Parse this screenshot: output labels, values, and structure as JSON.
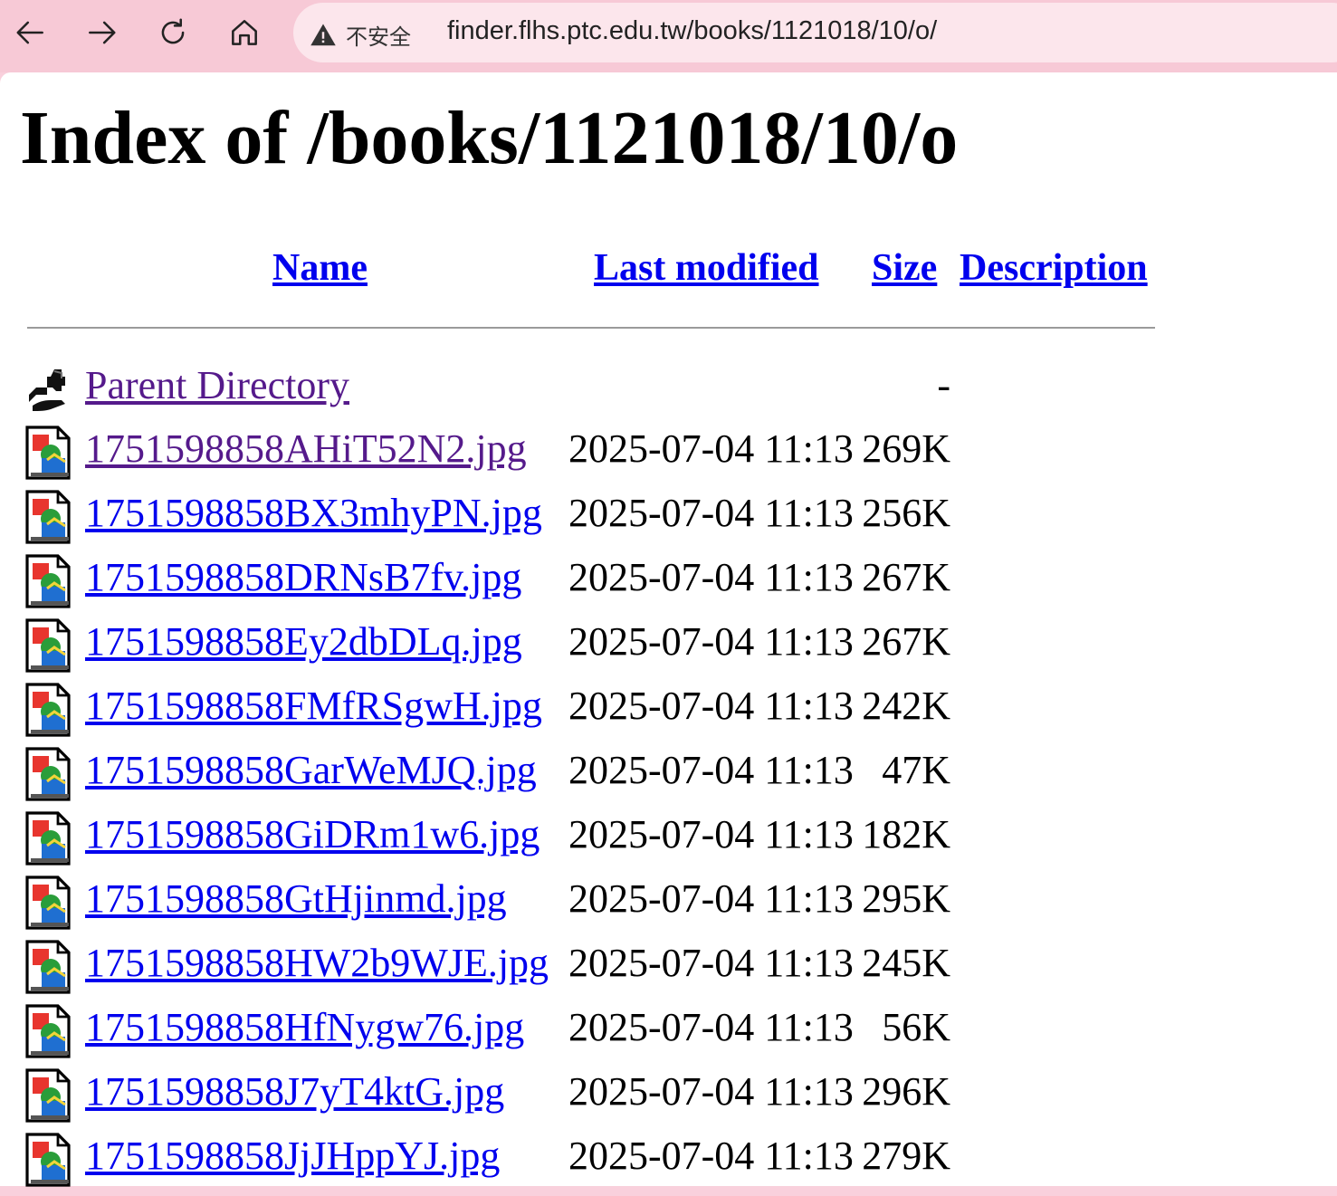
{
  "browser": {
    "security_label": "不安全",
    "url": "finder.flhs.ptc.edu.tw/books/1121018/10/o/"
  },
  "page": {
    "title": "Index of /books/1121018/10/o",
    "headers": {
      "name": "Name",
      "last_modified": "Last modified",
      "size": "Size",
      "description": "Description"
    },
    "parent": {
      "label": "Parent Directory",
      "size": "-"
    },
    "files": [
      {
        "name": "1751598858AHiT52N2.jpg",
        "modified": "2025-07-04 11:13",
        "size": "269K",
        "description": "",
        "visited": true
      },
      {
        "name": "1751598858BX3mhyPN.jpg",
        "modified": "2025-07-04 11:13",
        "size": "256K",
        "description": "",
        "visited": false
      },
      {
        "name": "1751598858DRNsB7fv.jpg",
        "modified": "2025-07-04 11:13",
        "size": "267K",
        "description": "",
        "visited": false
      },
      {
        "name": "1751598858Ey2dbDLq.jpg",
        "modified": "2025-07-04 11:13",
        "size": "267K",
        "description": "",
        "visited": false
      },
      {
        "name": "1751598858FMfRSgwH.jpg",
        "modified": "2025-07-04 11:13",
        "size": "242K",
        "description": "",
        "visited": false
      },
      {
        "name": "1751598858GarWeMJQ.jpg",
        "modified": "2025-07-04 11:13",
        "size": "47K",
        "description": "",
        "visited": false
      },
      {
        "name": "1751598858GiDRm1w6.jpg",
        "modified": "2025-07-04 11:13",
        "size": "182K",
        "description": "",
        "visited": false
      },
      {
        "name": "1751598858GtHjinmd.jpg",
        "modified": "2025-07-04 11:13",
        "size": "295K",
        "description": "",
        "visited": false
      },
      {
        "name": "1751598858HW2b9WJE.jpg",
        "modified": "2025-07-04 11:13",
        "size": "245K",
        "description": "",
        "visited": false
      },
      {
        "name": "1751598858HfNygw76.jpg",
        "modified": "2025-07-04 11:13",
        "size": "56K",
        "description": "",
        "visited": false
      },
      {
        "name": "1751598858J7yT4ktG.jpg",
        "modified": "2025-07-04 11:13",
        "size": "296K",
        "description": "",
        "visited": false
      },
      {
        "name": "1751598858JjJHppYJ.jpg",
        "modified": "2025-07-04 11:13",
        "size": "279K",
        "description": "",
        "visited": false
      }
    ]
  }
}
